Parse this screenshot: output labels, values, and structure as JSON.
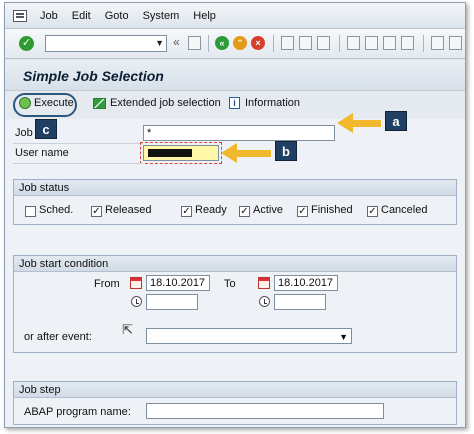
{
  "menu": [
    "Job",
    "Edit",
    "Goto",
    "System",
    "Help"
  ],
  "toolbar": {
    "command_field_value": ""
  },
  "page_title": "Simple Job Selection",
  "app_toolbar": {
    "execute": "Execute",
    "extended": "Extended job selection",
    "information": "Information"
  },
  "fields": {
    "job_label": "Job",
    "job_value": "*",
    "user_label": "User name"
  },
  "job_status": {
    "title": "Job status",
    "items": [
      {
        "label": "Sched.",
        "checked": false
      },
      {
        "label": "Released",
        "checked": true
      },
      {
        "label": "Ready",
        "checked": true
      },
      {
        "label": "Active",
        "checked": true
      },
      {
        "label": "Finished",
        "checked": true
      },
      {
        "label": "Canceled",
        "checked": true
      }
    ]
  },
  "job_start": {
    "title": "Job start condition",
    "from_label": "From",
    "to_label": "To",
    "from_date": "18.10.2017",
    "to_date": "18.10.2017",
    "after_event_label": "or after event:"
  },
  "job_step": {
    "title": "Job step",
    "abap_label": "ABAP program name:"
  },
  "callouts": {
    "a": "a",
    "b": "b",
    "c": "c"
  },
  "colors": {
    "arrow": "#f0b82a",
    "callout": "#1f3f63",
    "accent_ring": "#2a577f"
  }
}
